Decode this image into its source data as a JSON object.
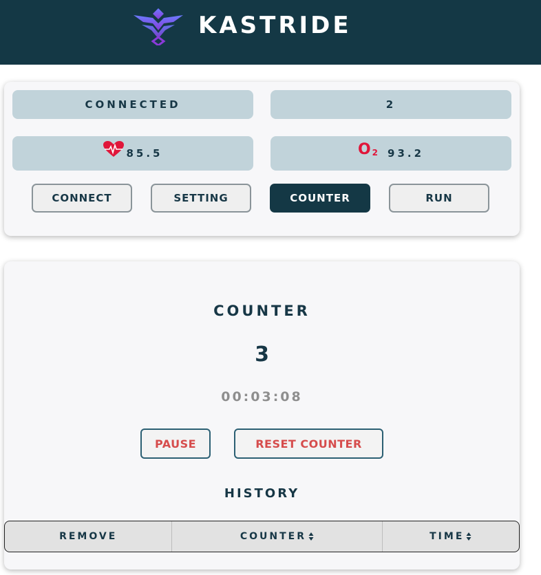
{
  "header": {
    "brand": "KASTRIDE",
    "logo_icon": "kastride-logo-icon"
  },
  "status": {
    "connection": "CONNECTED",
    "count": "2",
    "heart_rate": "85.5",
    "heart_icon": "heart-pulse-icon",
    "o2_symbol": "O",
    "o2_subscript": "2",
    "o2_value": "93.2"
  },
  "tabs": [
    {
      "label": "CONNECT",
      "active": false
    },
    {
      "label": "SETTING",
      "active": false
    },
    {
      "label": "COUNTER",
      "active": true
    },
    {
      "label": "RUN",
      "active": false
    }
  ],
  "counter": {
    "title": "COUNTER",
    "value": "3",
    "timer": "00:03:08",
    "pause_label": "PAUSE",
    "reset_label": "RESET COUNTER"
  },
  "history": {
    "title": "HISTORY",
    "columns": [
      "REMOVE",
      "COUNTER",
      "TIME"
    ]
  },
  "colors": {
    "header_bg": "#143845",
    "accent_red": "#d64c4c",
    "tile_bg": "#c1d3da",
    "heart": "#e0163a"
  }
}
